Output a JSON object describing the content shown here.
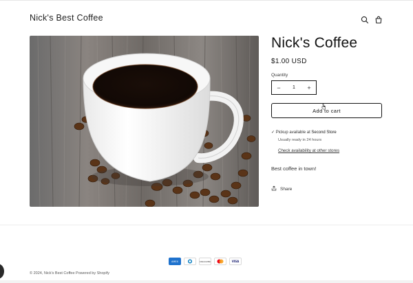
{
  "header": {
    "store_name": "Nick's Best Coffee",
    "search_icon": "search-icon",
    "cart_icon": "cart-icon"
  },
  "product": {
    "title": "Nick's Coffee",
    "price": "$1.00 USD",
    "quantity_label": "Quantity",
    "quantity_value": "1",
    "decrease_symbol": "−",
    "increase_symbol": "+",
    "add_to_cart": "Add to cart",
    "pickup_prefix": "Pickup available at",
    "pickup_location": "Second Store",
    "ready_text": "Usually ready in 24 hours",
    "check_availability": "Check availability at other stores",
    "description": "Best coffee in town!",
    "share_label": "Share"
  },
  "footer": {
    "payments": [
      {
        "name": "American Express",
        "label": "AMEX",
        "color": "#1f72cd"
      },
      {
        "name": "Diners Club",
        "label": "D",
        "color": "#0079be"
      },
      {
        "name": "Discover",
        "label": "DISCOVER",
        "color": "#231f20"
      },
      {
        "name": "Mastercard",
        "label": "MC",
        "color": "#eb001b"
      },
      {
        "name": "Visa",
        "label": "VISA",
        "color": "#1a1f71"
      }
    ],
    "copyright": "© 2024, Nick's Best Coffee Powered by Shopify"
  },
  "colors": {
    "text": "#121212",
    "border": "#121212",
    "background": "#ffffff"
  }
}
